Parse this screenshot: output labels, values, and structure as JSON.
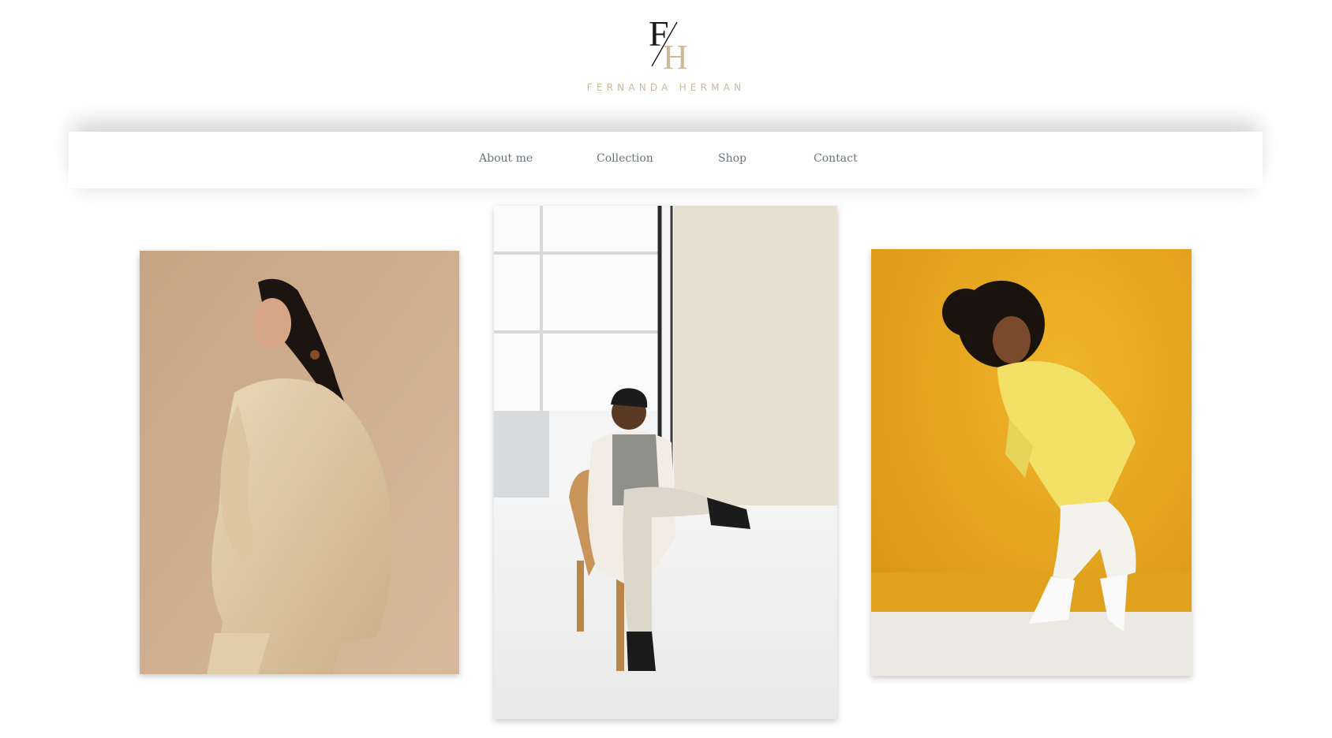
{
  "brand": {
    "monogram_letters": [
      "F",
      "H"
    ],
    "name": "FERNANDA HERMAN",
    "colors": {
      "primary": "#1a1a1a",
      "accent": "#cbb99a"
    }
  },
  "nav": {
    "items": [
      {
        "label": "About me"
      },
      {
        "label": "Collection"
      },
      {
        "label": "Shop"
      },
      {
        "label": "Contact"
      }
    ],
    "text_color": "#6b7478"
  },
  "gallery": {
    "photos": [
      {
        "name": "woman-beige-suit-photo",
        "background": "#c8a888"
      },
      {
        "name": "man-seated-white-room-photo",
        "background": "#f2f2f2"
      },
      {
        "name": "woman-yellow-jacket-photo",
        "background": "#e6a620"
      }
    ]
  }
}
